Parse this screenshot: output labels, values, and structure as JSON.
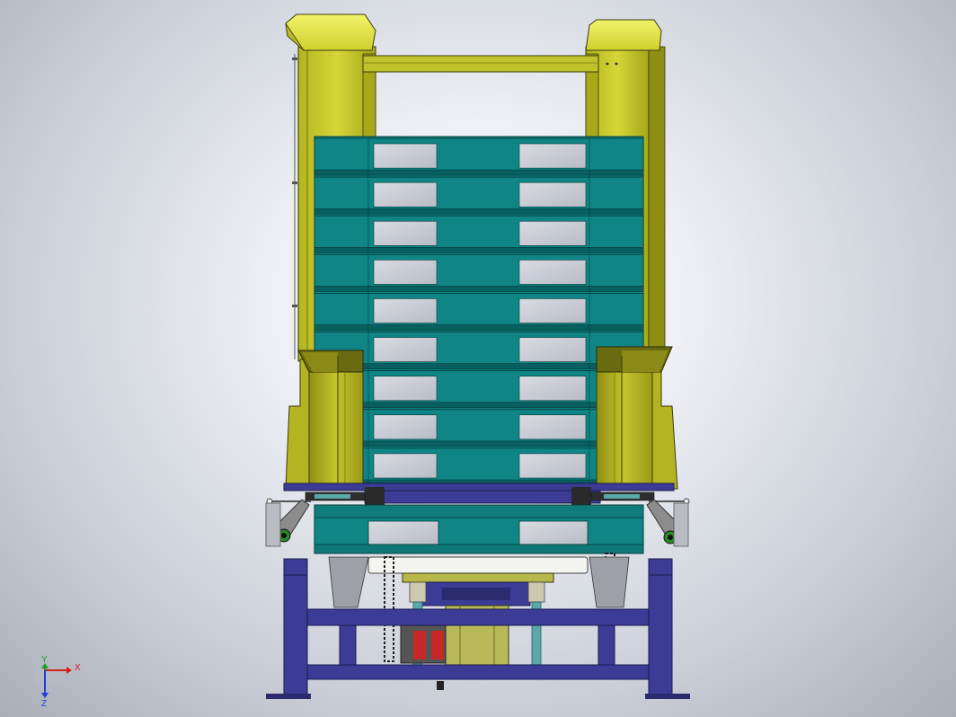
{
  "axes_triad": {
    "x_label": "X",
    "y_label": "Y",
    "z_label": "Z"
  },
  "colors": {
    "frame": "#c8c82a",
    "frame_shade": "#9a9a18",
    "pallet": "#0f8585",
    "pallet_dark": "#085f5f",
    "base": "#3c3c96",
    "base_dark": "#2a2a6e",
    "chain": "#222222",
    "cylinder": "#5aa9a9",
    "red_part": "#c82828",
    "white_part": "#f4f4f0",
    "axis_x": "#d62020",
    "axis_y": "#20a020",
    "axis_z": "#2040d6"
  },
  "pallet_stack": {
    "pallet_count": 9
  }
}
